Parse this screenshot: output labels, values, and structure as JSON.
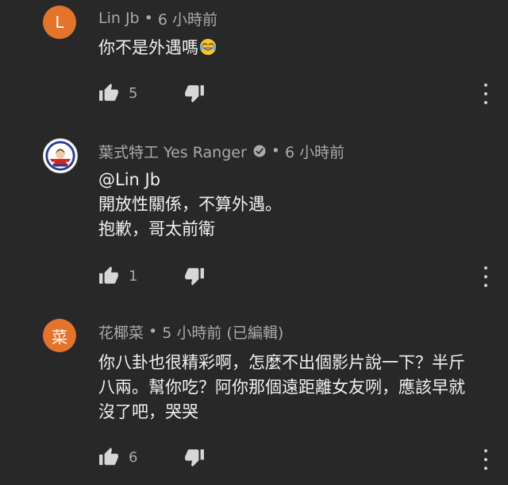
{
  "comments": [
    {
      "avatar_letter": "L",
      "avatar_color": "#e4742b",
      "author": "Lin Jb",
      "separator": "•",
      "time": "6 小時前",
      "lines": [
        "你不是外遇嗎"
      ],
      "emoji": "face-with-tears-of-joy-icon",
      "like_count": "5"
    },
    {
      "avatar_letter": "",
      "avatar_color": "#ffffff",
      "author": "葉式特工 Yes Ranger",
      "verified": true,
      "separator": "•",
      "time": "6 小時前",
      "lines": [
        "@Lin Jb",
        "開放性關係，不算外遇。",
        "抱歉，哥太前衛"
      ],
      "like_count": "1"
    },
    {
      "avatar_letter": "菜",
      "avatar_color": "#e4742b",
      "author": "花椰菜",
      "separator": "•",
      "time": "5 小時前 (已編輯)",
      "lines": [
        "你八卦也很精彩啊，怎麼不出個影片說一下？半斤",
        "八兩。幫你吃？阿你那個遠距離女友咧，應該早就",
        "沒了吧，哭哭"
      ],
      "like_count": "6"
    }
  ]
}
